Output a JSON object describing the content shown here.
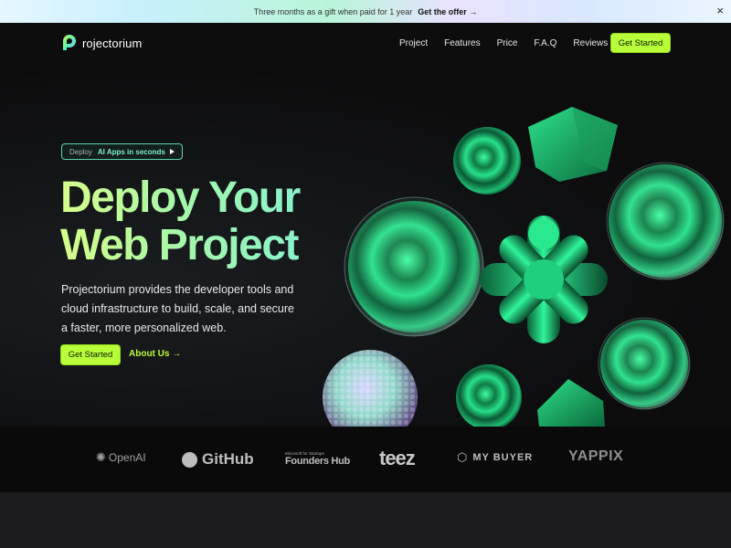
{
  "announcement": {
    "text": "Three months as a gift when paid for 1 year",
    "offer": "Get the offer",
    "close": "×"
  },
  "header": {
    "brand": "rojectorium",
    "nav": [
      "Project",
      "Features",
      "Price",
      "F.A.Q",
      "Reviews"
    ],
    "cta": "Get Started"
  },
  "hero": {
    "chip_lead": "Deploy",
    "chip_highlight": "AI Apps in seconds",
    "title_line1": "Deploy Your",
    "title_line2": "Web Project",
    "description": "Projectorium provides the developer tools and cloud infrastructure to build, scale, and secure a faster, more personalized web.",
    "primary_button": "Get Started",
    "secondary_link": "About Us",
    "secondary_arrow": "→"
  },
  "logos": {
    "openai": "OpenAI",
    "github": "GitHub",
    "founders_small": "Microsoft for Startups",
    "founders_big": "Founders Hub",
    "teez": "teez",
    "mybuyer": "MY BUYER",
    "yappix": "YAPPIX"
  },
  "colors": {
    "accent": "#b8ff3a",
    "teal": "#7ff0c8",
    "background": "#0b0b0c"
  }
}
